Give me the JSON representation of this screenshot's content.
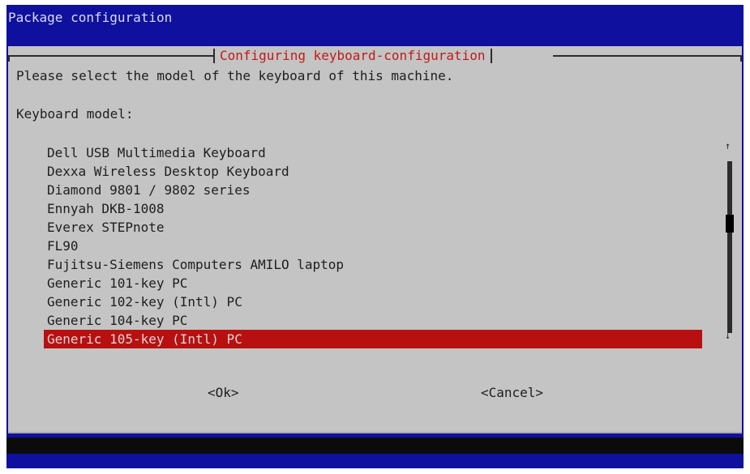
{
  "window": {
    "title": "Package configuration"
  },
  "dialog": {
    "title": "Configuring keyboard-configuration",
    "prompt": "Please select the model of the keyboard of this machine.",
    "field_label": "Keyboard model:",
    "selected_model": "Generic 105-key (Intl) PC",
    "models": [
      "Dell USB Multimedia Keyboard",
      "Dexxa Wireless Desktop Keyboard",
      "Diamond 9801 / 9802 series",
      "Ennyah DKB-1008",
      "Everex STEPnote",
      "FL90",
      "Fujitsu-Siemens Computers AMILO laptop",
      "Generic 101-key PC",
      "Generic 102-key (Intl) PC",
      "Generic 104-key PC",
      "Generic 105-key (Intl) PC"
    ],
    "buttons": {
      "ok": "<Ok>",
      "cancel": "<Cancel>"
    },
    "scroll": {
      "up": "↑",
      "down": "↓"
    }
  },
  "colors": {
    "background_blue": "#10109e",
    "dialog_gray": "#c4c4c4",
    "title_red": "#c11a1a",
    "selection_red": "#b81010"
  }
}
